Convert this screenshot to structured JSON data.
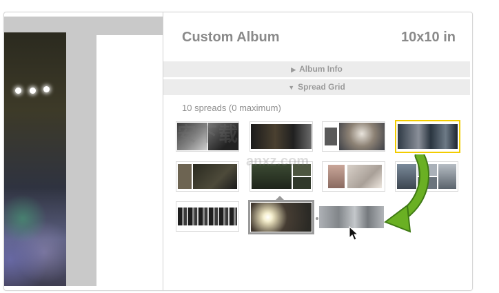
{
  "album": {
    "title": "Custom Album",
    "size": "10x10 in"
  },
  "sections": {
    "album_info": "Album Info",
    "spread_grid": "Spread Grid"
  },
  "spread_count": "10 spreads (0 maximum)",
  "watermark": {
    "logo_text": "安下载",
    "domain": "anxz.com"
  },
  "colors": {
    "selection": "#f2cc00",
    "move_arrow": "#6ab023",
    "panel_text": "#8a8a8a"
  },
  "icons": {
    "collapsed": "triangle-right-icon",
    "expanded": "triangle-down-icon",
    "pointer": "mouse-cursor-icon",
    "move": "curved-arrow-icon"
  }
}
